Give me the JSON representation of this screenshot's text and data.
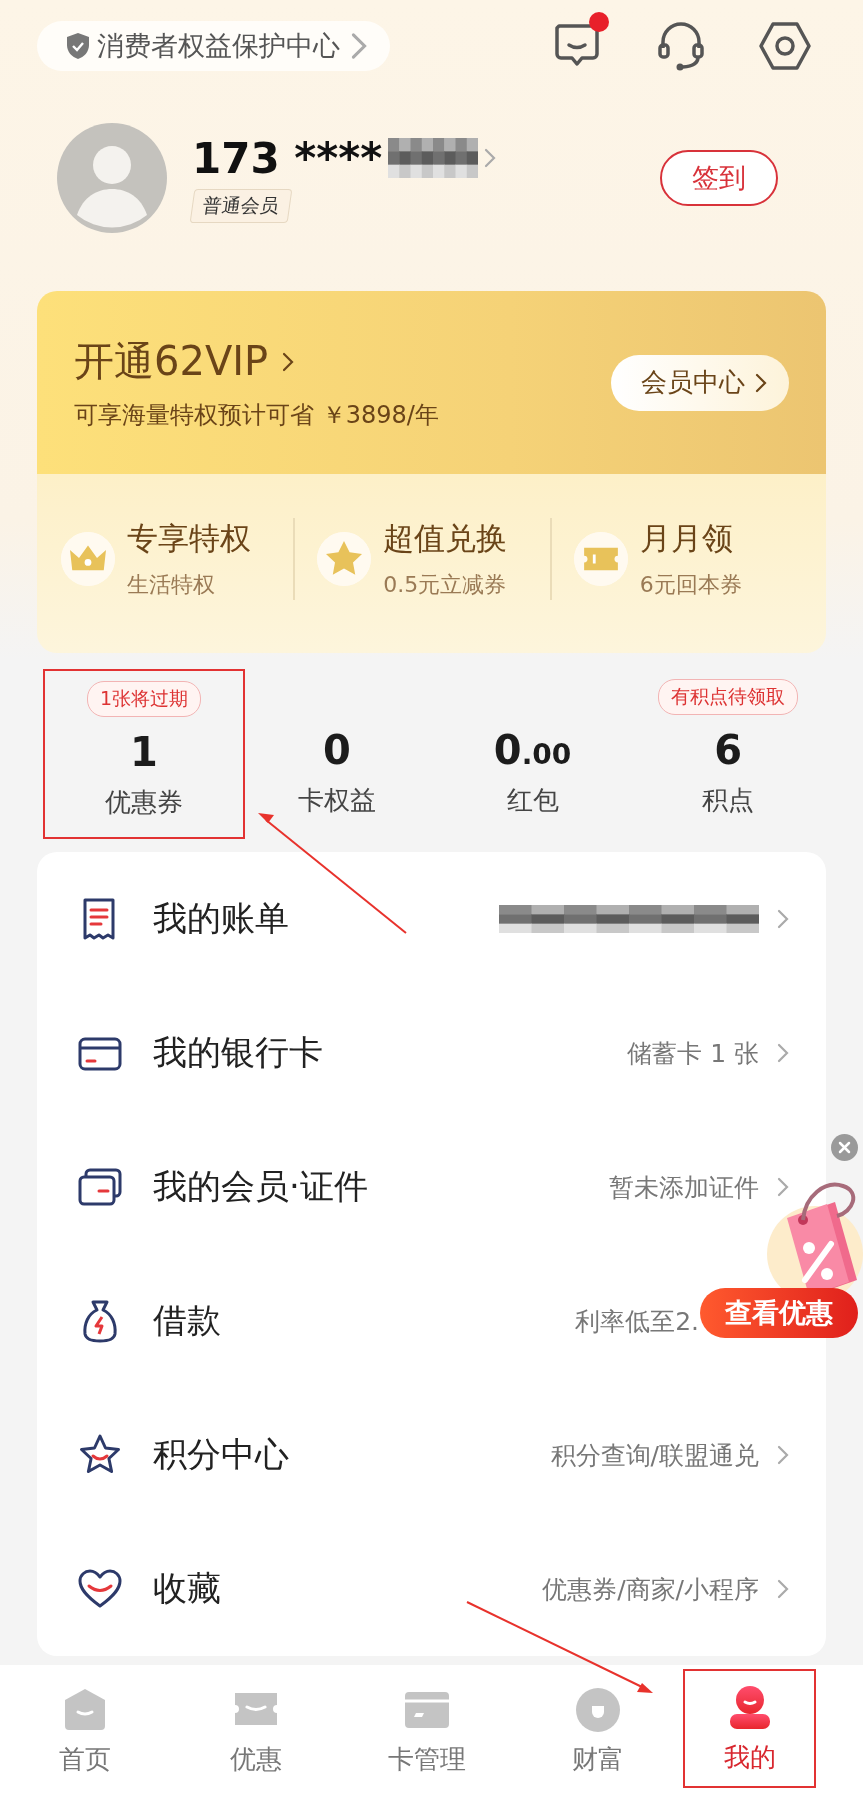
{
  "top_bar": {
    "consumer_link": "消费者权益保护中心",
    "message_unread": true
  },
  "profile": {
    "phone": "173 ****",
    "phone_redacted": true,
    "level_badge": "普通会员",
    "checkin_button": "签到"
  },
  "vip_card": {
    "title": "开通62VIP",
    "subtitle": "可享海量特权预计可省 ￥3898/年",
    "center_button": "会员中心",
    "benefits": [
      {
        "kind": "crown",
        "title": "专享特权",
        "detail": "生活特权"
      },
      {
        "kind": "star",
        "title": "超值兑换",
        "detail": "0.5元立减券"
      },
      {
        "kind": "ticket",
        "title": "月月领",
        "detail": "6元回本券"
      }
    ]
  },
  "stats": [
    {
      "tag": "1张将过期",
      "value": "1",
      "label": "优惠券",
      "annotated": true
    },
    {
      "value": "0",
      "label": "卡权益",
      "annotated": false
    },
    {
      "value": "0",
      "value_small": ".00",
      "label": "红包",
      "annotated": false
    },
    {
      "tag": "有积点待领取",
      "value": "6",
      "label": "积点",
      "annotated": false
    }
  ],
  "menu": [
    {
      "kind": "bill",
      "label": "我的账单",
      "detail_redacted": true,
      "chevron": true
    },
    {
      "kind": "card",
      "label": "我的银行卡",
      "detail": "储蓄卡 1 张",
      "detail_redacted": false,
      "chevron": true
    },
    {
      "kind": "member",
      "label": "我的会员·证件",
      "detail": "暂未添加证件",
      "detail_redacted": false,
      "chevron": true
    },
    {
      "kind": "loan",
      "label": "借款",
      "detail": "利率低至2.",
      "detail_redacted": false,
      "chevron": false
    },
    {
      "kind": "points",
      "label": "积分中心",
      "detail": "积分查询/联盟通兑",
      "detail_redacted": false,
      "chevron": true
    },
    {
      "kind": "favorite",
      "label": "收藏",
      "detail": "优惠券/商家/小程序",
      "detail_redacted": false,
      "chevron": true
    }
  ],
  "promo": {
    "button": "查看优惠"
  },
  "nav": [
    {
      "kind": "home",
      "label": "首页",
      "selected": false,
      "annotated": false
    },
    {
      "kind": "coupon",
      "label": "优惠",
      "selected": false,
      "annotated": false
    },
    {
      "kind": "card",
      "label": "卡管理",
      "selected": false,
      "annotated": false
    },
    {
      "kind": "wealth",
      "label": "财富",
      "selected": false,
      "annotated": false
    },
    {
      "kind": "me",
      "label": "我的",
      "selected": true,
      "annotated": true
    }
  ]
}
